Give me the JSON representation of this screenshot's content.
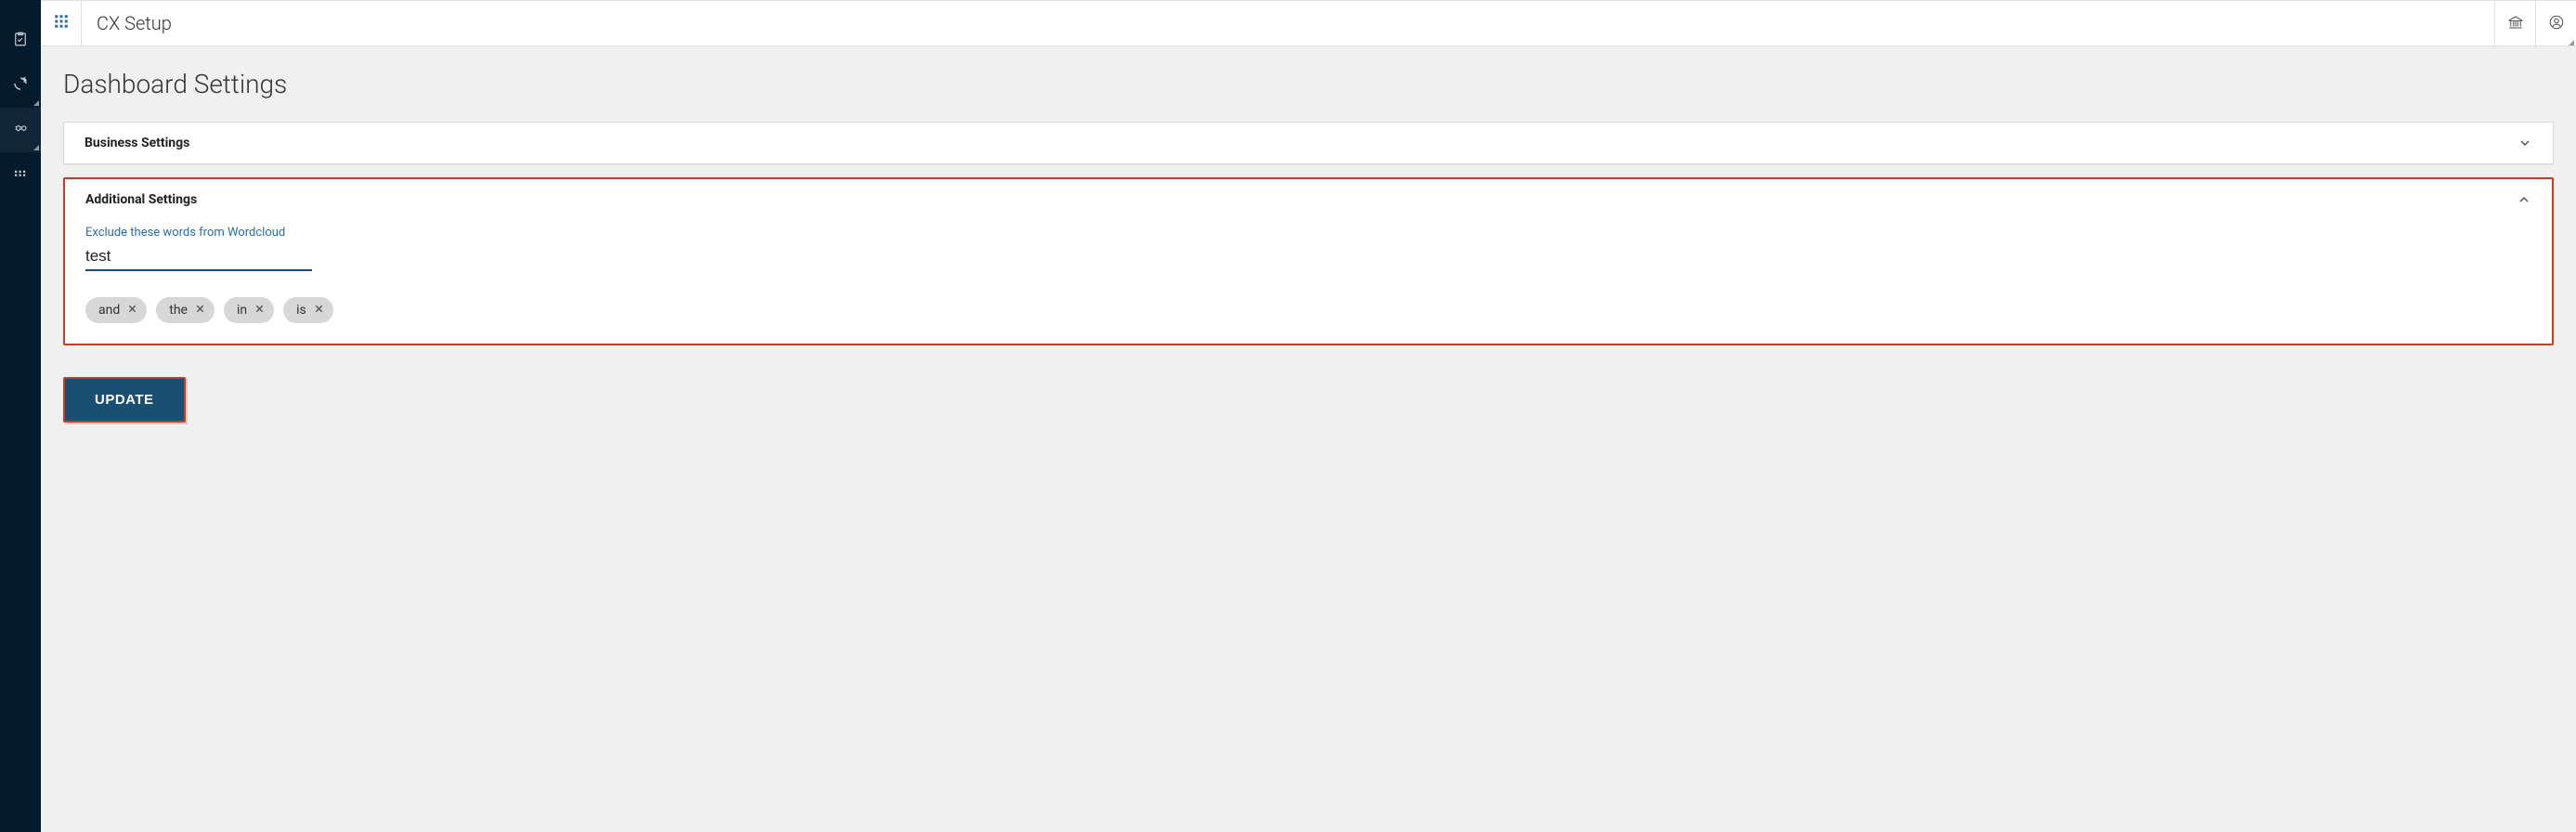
{
  "header": {
    "app_title": "CX Setup"
  },
  "page": {
    "title": "Dashboard Settings"
  },
  "panels": {
    "business": {
      "title": "Business Settings"
    },
    "additional": {
      "title": "Additional Settings",
      "field_label": "Exclude these words from Wordcloud",
      "input_value": "test",
      "chips": [
        "and",
        "the",
        "in",
        "is"
      ]
    }
  },
  "actions": {
    "update_label": "UPDATE"
  },
  "icons": {
    "app_switcher": "apps-icon",
    "rail_checklist": "checklist-icon",
    "rail_share": "share-icon",
    "rail_settings": "settings-gear-icon",
    "rail_grid": "grid-small-icon",
    "bank": "bank-icon",
    "user": "user-circle-icon",
    "chevron_down": "chevron-down-icon",
    "chevron_up": "chevron-up-icon",
    "close": "close-icon"
  }
}
